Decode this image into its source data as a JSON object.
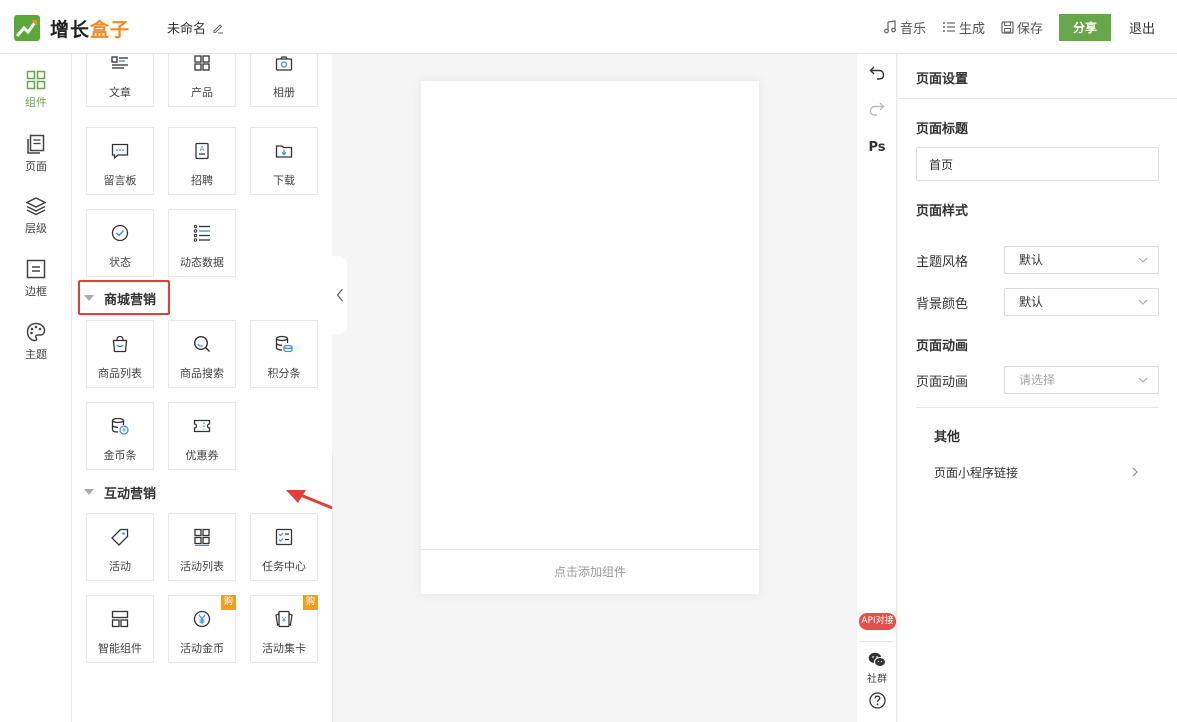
{
  "app": {
    "logo_part1": "增长",
    "logo_part2": "盒子",
    "doc_name": "未命名"
  },
  "header": {
    "music": "音乐",
    "generate": "生成",
    "save": "保存",
    "share": "分享",
    "exit": "退出"
  },
  "nav": [
    {
      "label": "组件",
      "icon": "grid-icon",
      "active": true
    },
    {
      "label": "页面",
      "icon": "pages-icon"
    },
    {
      "label": "层级",
      "icon": "layers-icon"
    },
    {
      "label": "边框",
      "icon": "border-icon"
    },
    {
      "label": "主题",
      "icon": "palette-icon"
    }
  ],
  "components": {
    "basic": [
      "文章",
      "产品",
      "相册",
      "留言板",
      "招聘",
      "下载",
      "状态",
      "动态数据"
    ],
    "mall_title": "商城营销",
    "mall": [
      "商品列表",
      "商品搜索",
      "积分条",
      "金币条",
      "优惠券"
    ],
    "interactive_title": "互动营销",
    "interactive": [
      "活动",
      "活动列表",
      "任务中心",
      "智能组件",
      "活动金币",
      "活动集卡"
    ],
    "badge": "购"
  },
  "canvas": {
    "add_component": "点击添加组件"
  },
  "toolstrip": {
    "ps": "Ps",
    "api": "API对接",
    "social": "社群"
  },
  "settings": {
    "title": "页面设置",
    "page_title_h": "页面标题",
    "page_title_value": "首页",
    "page_style_h": "页面样式",
    "theme_label": "主题风格",
    "theme_value": "默认",
    "bg_label": "背景颜色",
    "bg_value": "默认",
    "anim_h": "页面动画",
    "anim_label": "页面动画",
    "anim_placeholder": "请选择",
    "other_h": "其他",
    "mini_link": "页面小程序链接"
  },
  "colors": {
    "accent": "#67a64a",
    "brand_orange": "#f08a24",
    "highlight": "#e0403a",
    "badge": "#f0a020"
  }
}
